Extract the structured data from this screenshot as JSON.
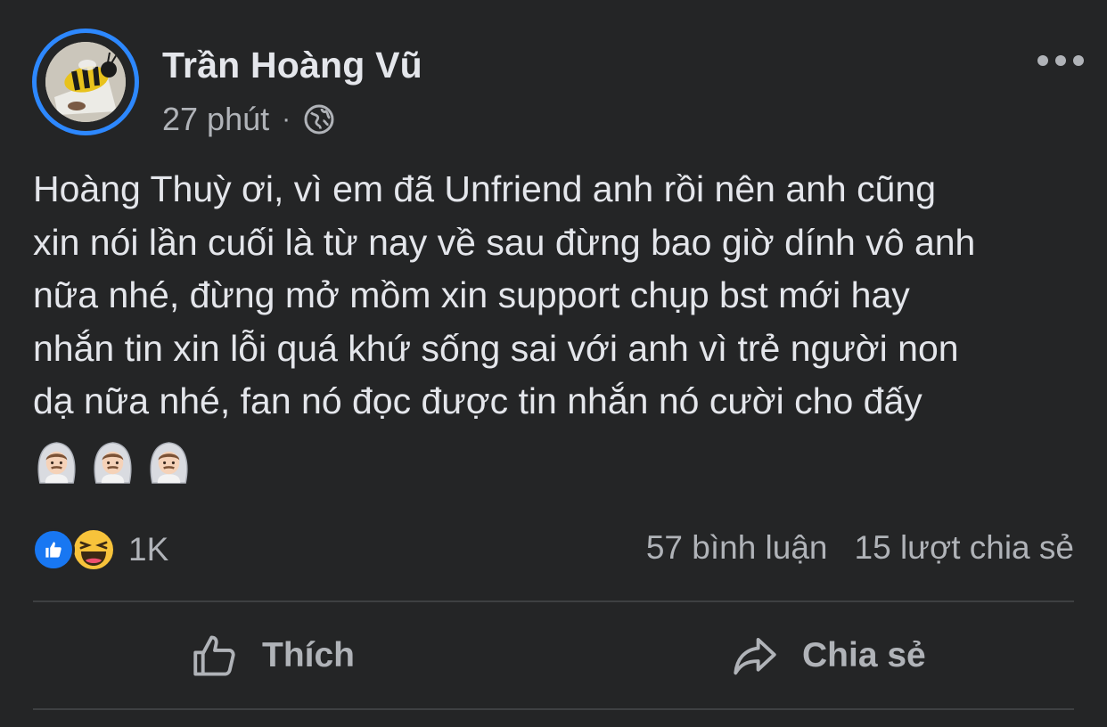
{
  "post": {
    "author": "Trần Hoàng Vũ",
    "time": "27 phút",
    "separator": "·",
    "privacy_icon": "globe-icon",
    "text": "Hoàng Thuỳ ơi, vì em đã Unfriend anh rồi nên anh cũng\nxin nói lần cuối là từ nay về sau đừng bao giờ dính vô anh\nnữa nhé, đừng mở mồm xin support chụp bst mới hay\nnhắn tin xin lỗi quá khứ sống sai với anh vì trẻ người non\ndạ nữa nhé, fan nó đọc được tin nhắn nó cười cho đấy",
    "emojis": [
      "man-with-veil-emoji",
      "man-with-veil-emoji",
      "man-with-veil-emoji"
    ]
  },
  "reactions": {
    "icons": [
      "like-icon",
      "haha-icon"
    ],
    "count": "1K"
  },
  "stats": {
    "comments": "57 bình luận",
    "shares": "15 lượt chia sẻ"
  },
  "actions": {
    "like_label": "Thích",
    "share_label": "Chia sẻ"
  },
  "colors": {
    "background": "#242526",
    "text": "#e4e6eb",
    "secondary_text": "#b0b3b8",
    "accent": "#2d88ff",
    "like_blue": "#1877f2"
  }
}
